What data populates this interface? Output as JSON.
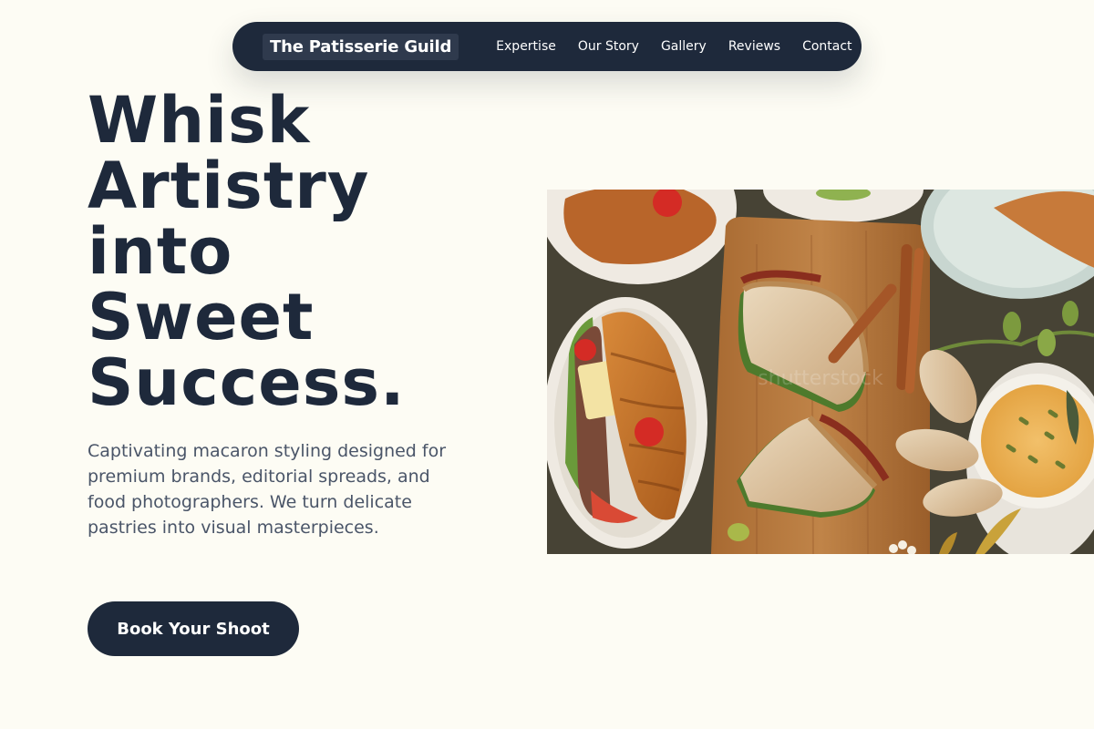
{
  "nav": {
    "brand": "The Patisserie Guild",
    "links": [
      "Expertise",
      "Our Story",
      "Gallery",
      "Reviews",
      "Contact"
    ]
  },
  "hero": {
    "title_lines": [
      "Whisk",
      "Artistry",
      "into",
      "Sweet",
      "Success."
    ],
    "subtitle": "Captivating macaron styling designed for premium brands, editorial spreads, and food photographers. We turn delicate pastries into visual masterpieces.",
    "cta_label": "Book Your Shoot",
    "image_watermark": "shutterstock"
  },
  "colors": {
    "background": "#fdfcf4",
    "navy": "#1e293b",
    "body_text": "#4a5568"
  }
}
